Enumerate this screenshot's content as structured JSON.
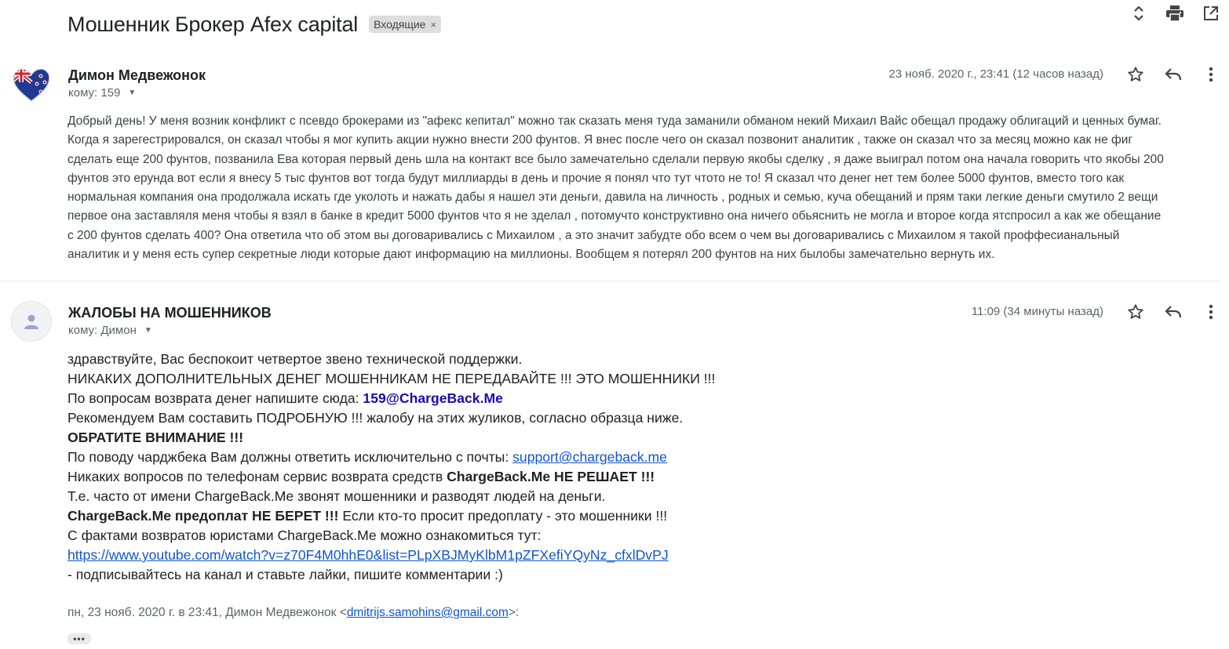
{
  "thread": {
    "subject": "Мошенник Брокер Afex capital",
    "label": "Входящие",
    "label_remove": "×",
    "actions": [
      "expand-collapse-icon",
      "print-icon",
      "open-new-window-icon"
    ]
  },
  "messages": [
    {
      "sender": "Димон Медвежонок",
      "to_label": "кому: 159",
      "date": "23 нояб. 2020 г., 23:41 (12 часов назад)",
      "avatar": "new-zealand-flag-heart",
      "lines": [
        "Добрый день! У меня возник конфликт с псевдо брокерами из \"афекс кепитал\" можно так сказать меня туда заманили обманом некий Михаил Вайс обещал продажу облигаций и ценных бумаг.",
        "Когда я зарегестрировался, он сказал чтобы я мог купить акции нужно внести 200 фунтов. Я внес после чего он сказал позвонит аналитик , также он сказал что за месяц можно как не фиг",
        "сделать еще 200 фунтов, позванила Ева которая первый день шла на контакт все было замечательно сделали первую якобы сделку , я даже выиграл потом она начала говорить что якобы 200",
        "фунтов это ерунда вот если я внесу 5 тыс фунтов вот тогда будут миллиарды в день и прочие я понял что тут чтото не то! Я сказал что денег нет тем более  5000 фунтов, вместо того как",
        "нормальная компания она продолжала искать где уколоть и нажать дабы я нашел эти деньги, давила на личность , родных и семью, куча обещаний и прям таки легкие деньги смутило 2 вещи",
        "первое она заставляля меня чтобы я взял в банке в кредит 5000 фунтов что я не зделал , потомучто конструктивно она ничего обьяснить не могла и второе когда ятспросил а как же обещание",
        "с 200 фунтов сделать 400? Она ответила что об этом вы договаривались с Михаилом , а это значит забудте обо всем о чем вы договаривались с Михаилом я такой проффесианальный",
        "аналитик и у меня есть супер секретные люди которые дают информацию на миллионы. Вообщем я потерял 200 фунтов на них былобы замечательно вернуть их."
      ]
    },
    {
      "sender": "ЖАЛОБЫ НА МОШЕННИКОВ",
      "to_label": "кому: Димон",
      "date": "11:09 (34 минуты назад)",
      "avatar": "default-person",
      "body": {
        "l1": "здравствуйте, Вас беспокоит четвертое звено технической поддержки.",
        "l2": "НИКАКИХ ДОПОЛНИТЕЛЬНЫХ ДЕНЕГ МОШЕННИКАМ НЕ ПЕРЕДАВАЙТЕ !!! ЭТО МОШЕННИКИ !!!",
        "l3_text": "По вопросам возврата денег напишите сюда: ",
        "l3_email": "159@ChargeBack.Me",
        "l4": "Рекомендуем Вам составить ПОДРОБНУЮ !!! жалобу на этих жуликов, согласно образца ниже.",
        "l5": "ОБРАТИТЕ ВНИМАНИЕ !!!",
        "l6_text": "По поводу чарджбека Вам должны ответить исключительно с почты: ",
        "l6_email": "support@chargeback.me",
        "l7_text": "Никаких вопросов по телефонам сервис возврата средств ",
        "l7_bold": "ChargeBack.Me НЕ РЕШАЕТ !!!",
        "l8": "Т.е. часто от имени ChargeBack.Me звонят мошенники и разводят людей на деньги.",
        "l9_bold": "ChargeBack.Me предоплат НЕ БЕРЕТ !!!",
        "l9_text": " Если кто-то просит предоплату - это мошенники !!!",
        "l10": "С фактами возвратов юристами ChargeBack.Me можно ознакомиться тут:",
        "l11_link": "https://www.youtube.com/watch?v=z70F4M0hhE0&list=PLpXBJMyKlbM1pZFXefiYQyNz_cfxlDvPJ",
        "l12": " - подписывайтесь на канал и ставьте лайки, пишите комментарии :)"
      },
      "quote": {
        "prefix": "пн, 23 нояб. 2020 г. в 23:41, Димон Медвежонок <",
        "email": "dmitrijs.samohins@gmail.com",
        "suffix": ">:"
      },
      "ellipsis": "•••"
    }
  ],
  "colors": {
    "text": "#222222",
    "muted": "#5f6368",
    "email_link": "#1a0dab",
    "underline_link": "#1155cc",
    "chip_bg": "#dddddd"
  }
}
